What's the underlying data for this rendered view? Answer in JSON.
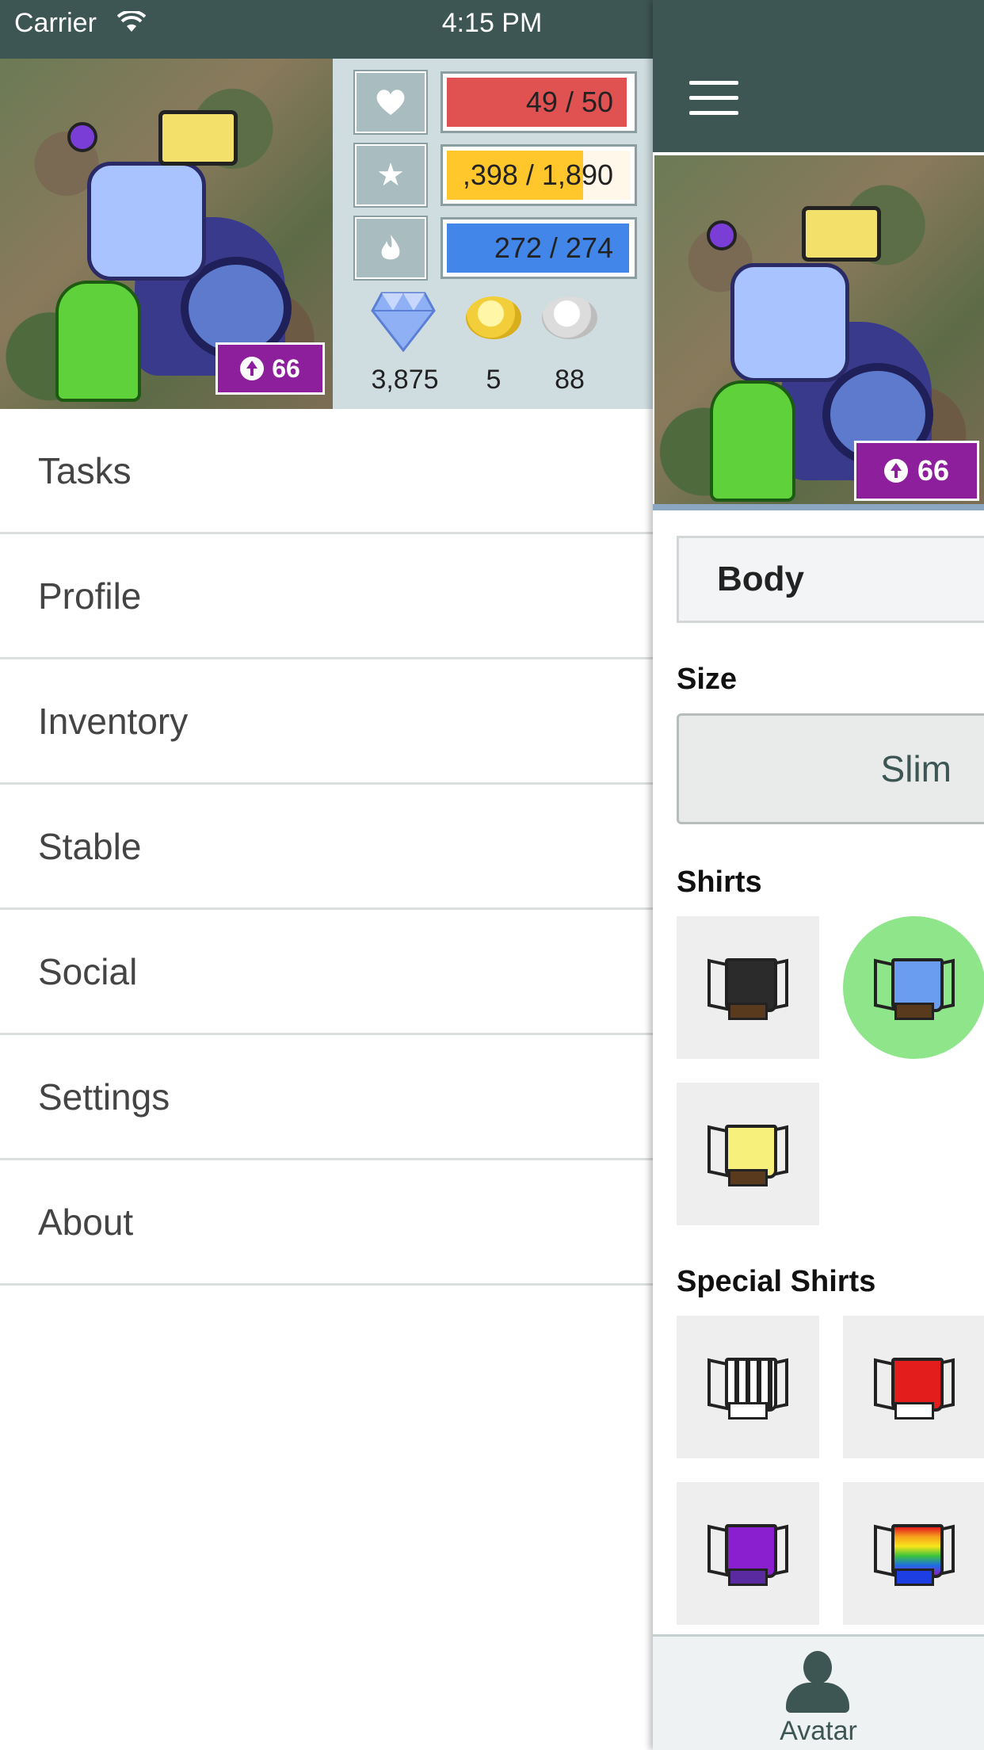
{
  "status_bar": {
    "carrier": "Carrier",
    "time": "4:15 PM"
  },
  "stats": {
    "health": {
      "icon": "heart-icon",
      "text": "49 / 50",
      "fraction": 0.98,
      "color": "#e05252",
      "track": "#ffffff"
    },
    "experience": {
      "icon": "star-icon",
      "text": ",398 / 1,890",
      "fraction": 0.74,
      "color": "#ffc72c",
      "track": "#fff8ea"
    },
    "mana": {
      "icon": "fire-icon",
      "text": "272 / 274",
      "fraction": 0.99,
      "color": "#4286ea",
      "track": "#ffffff"
    }
  },
  "currency": {
    "gems": "3,875",
    "gold": "5",
    "silver": "88"
  },
  "level": "66",
  "menu": {
    "items": [
      {
        "label": "Tasks"
      },
      {
        "label": "Profile"
      },
      {
        "label": "Inventory"
      },
      {
        "label": "Stable"
      },
      {
        "label": "Social"
      },
      {
        "label": "Settings"
      },
      {
        "label": "About"
      }
    ]
  },
  "panel": {
    "tab": "Body",
    "size_label": "Size",
    "size_value": "Slim",
    "shirts_label": "Shirts",
    "special_shirts_label": "Special Shirts",
    "shirt_colors": [
      "#2b2b2b",
      "#6a9cf0",
      "#f7f07a"
    ],
    "special_shirt_colors": [
      "#ffffff",
      "#e31c1c",
      "#8a1fd0",
      "rainbow"
    ],
    "selected_shirt": 1,
    "tab_bar_label": "Avatar"
  },
  "theme": {
    "header": "#3d5654",
    "level_badge": "#8d1f9c"
  }
}
